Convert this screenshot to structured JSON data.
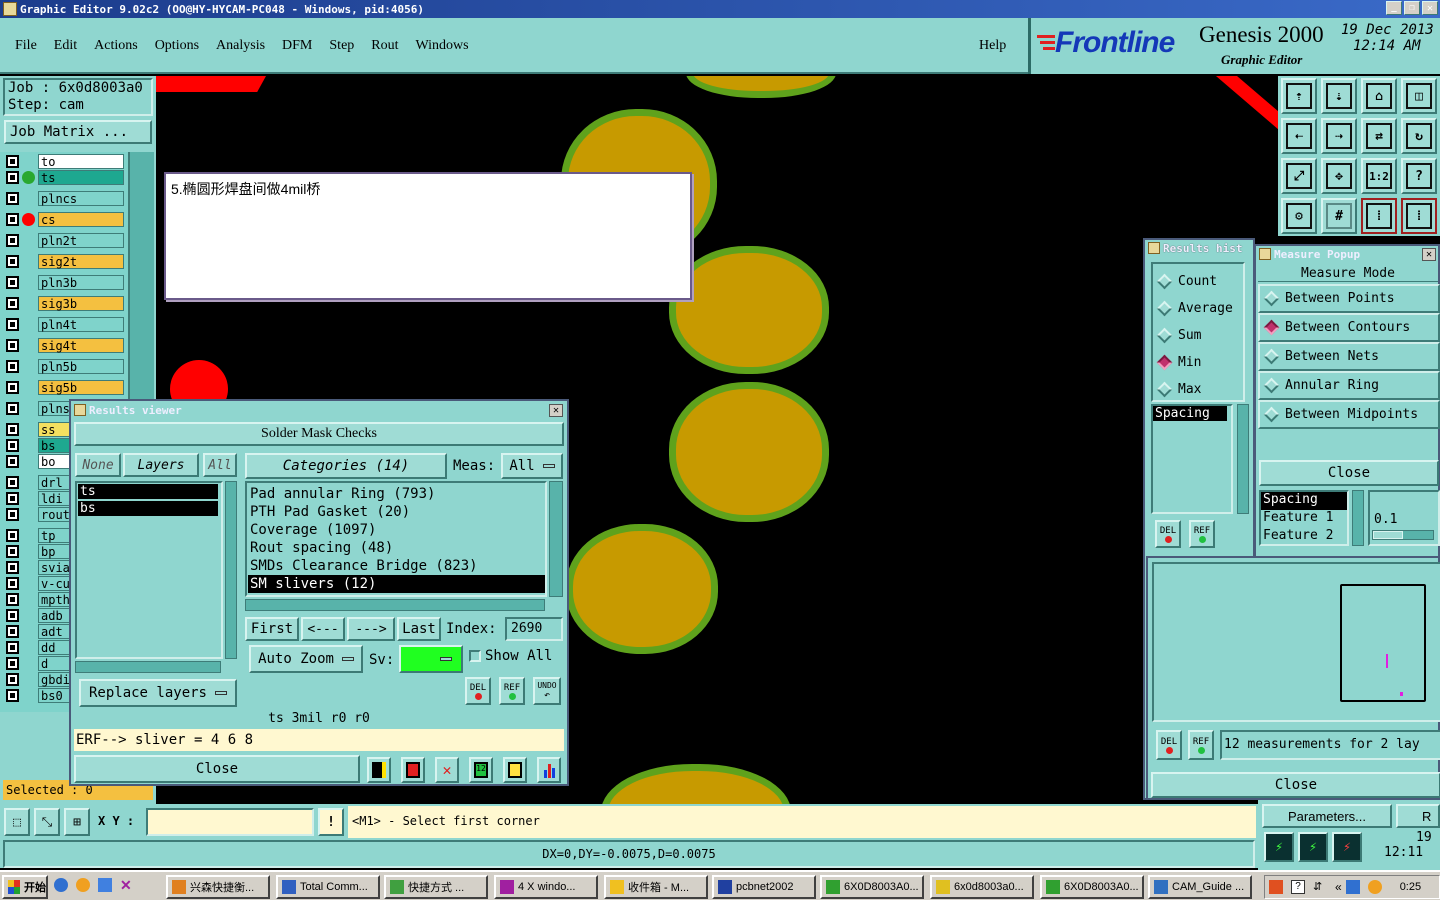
{
  "window": {
    "title": "Graphic Editor 9.02c2  (OO@HY-HYCAM-PC048 - Windows, pid:4056)"
  },
  "menu": {
    "items": [
      "File",
      "Edit",
      "Actions",
      "Options",
      "Analysis",
      "DFM",
      "Step",
      "Rout",
      "Windows"
    ],
    "help": "Help"
  },
  "brand": {
    "logo": "Frontline",
    "product": "Genesis 2000",
    "subtitle": "Graphic Editor",
    "date": "19 Dec 2013",
    "time": "12:14 AM"
  },
  "job": {
    "job_line": "Job  :  6x0d8003a0",
    "step_line": "Step: cam",
    "matrix_button": "Job Matrix ..."
  },
  "layers": [
    {
      "name": "to",
      "color": "#ffffff",
      "dot": ""
    },
    {
      "name": "ts",
      "color": "#1ea890",
      "dot": "#2aa830"
    },
    {
      "name": "plncs",
      "color": "#7fd3cb",
      "dot": ""
    },
    {
      "name": "cs",
      "color": "#f4c040",
      "dot": "#ff0000"
    },
    {
      "name": "pln2t",
      "color": "#7fd3cb",
      "dot": ""
    },
    {
      "name": "sig2t",
      "color": "#f4c040",
      "dot": ""
    },
    {
      "name": "pln3b",
      "color": "#7fd3cb",
      "dot": ""
    },
    {
      "name": "sig3b",
      "color": "#f4c040",
      "dot": ""
    },
    {
      "name": "pln4t",
      "color": "#7fd3cb",
      "dot": ""
    },
    {
      "name": "sig4t",
      "color": "#f4c040",
      "dot": ""
    },
    {
      "name": "pln5b",
      "color": "#7fd3cb",
      "dot": ""
    },
    {
      "name": "sig5b",
      "color": "#f4c040",
      "dot": ""
    },
    {
      "name": "plns",
      "color": "#7fd3cb",
      "dot": ""
    },
    {
      "name": "ss",
      "color": "#f4e060",
      "dot": ""
    },
    {
      "name": "bs",
      "color": "#1ea890",
      "dot": ""
    },
    {
      "name": "bo",
      "color": "#ffffff",
      "dot": ""
    },
    {
      "name": "drl",
      "color": "#7fd3cb",
      "dot": ""
    },
    {
      "name": "ldi",
      "color": "#7fd3cb",
      "dot": ""
    },
    {
      "name": "rout",
      "color": "#7fd3cb",
      "dot": ""
    },
    {
      "name": "tp",
      "color": "#7fd3cb",
      "dot": ""
    },
    {
      "name": "bp",
      "color": "#7fd3cb",
      "dot": ""
    },
    {
      "name": "svia",
      "color": "#7fd3cb",
      "dot": ""
    },
    {
      "name": "v-cu",
      "color": "#7fd3cb",
      "dot": ""
    },
    {
      "name": "mpth",
      "color": "#7fd3cb",
      "dot": ""
    },
    {
      "name": "adb",
      "color": "#7fd3cb",
      "dot": ""
    },
    {
      "name": "adt",
      "color": "#7fd3cb",
      "dot": ""
    },
    {
      "name": "dd",
      "color": "#7fd3cb",
      "dot": ""
    },
    {
      "name": "d",
      "color": "#7fd3cb",
      "dot": ""
    },
    {
      "name": "gbdi",
      "color": "#7fd3cb",
      "dot": ""
    },
    {
      "name": "bs0",
      "color": "#7fd3cb",
      "dot": ""
    }
  ],
  "selected": "Selected : 0",
  "note": {
    "text": "5.椭圆形焊盘间做4mil桥"
  },
  "results_viewer": {
    "title": "Results viewer",
    "header": "Solder Mask Checks",
    "tabs": {
      "none": "None",
      "layers": "Layers",
      "all": "All"
    },
    "layer_list": [
      "ts",
      "bs"
    ],
    "categories_label": "Categories (14)",
    "meas_label": "Meas:",
    "meas_value": "All",
    "categories": [
      "Pad annular Ring (793)",
      "PTH Pad Gasket (20)",
      "Coverage (1097)",
      "Rout spacing (48)",
      "SMDs Clearance Bridge (823)",
      "SM slivers (12)"
    ],
    "nav": {
      "first": "First",
      "prev": "<---",
      "next": "--->",
      "last": "Last",
      "index_label": "Index:",
      "index_value": "2690"
    },
    "auto_zoom": "Auto Zoom",
    "sv_label": "Sv:",
    "show_all": "Show All",
    "replace_layers": "Replace layers",
    "btn_del": "DEL",
    "btn_ref": "REF",
    "btn_undo": "UNDO",
    "info": "ts 3mil  r0  r0",
    "erf": "ERF--> sliver = 4 6 8",
    "close": "Close"
  },
  "results_history": {
    "title": "Results hist",
    "options": [
      "Count",
      "Average",
      "Sum",
      "Min",
      "Max"
    ],
    "selected": "Min",
    "list_item": "Spacing",
    "btn_del": "DEL",
    "btn_ref": "REF"
  },
  "measure_popup": {
    "title": "Measure Popup",
    "mode_label": "Measure Mode",
    "modes": [
      "Between Points",
      "Between Contours",
      "Between Nets",
      "Annular Ring",
      "Between Midpoints"
    ],
    "selected": "Between Contours",
    "close": "Close",
    "spacing_items": [
      "Spacing",
      "Feature 1",
      "Feature 2"
    ],
    "value": "0.1",
    "measurements": "12 measurements for 2 lay",
    "btn_del": "DEL",
    "btn_ref": "REF",
    "close2": "Close"
  },
  "command": {
    "xy_label": "X Y :",
    "xy_value": "",
    "prompt": "<M1> - Select first corner",
    "status": "DX=0,DY=-0.0075,D=0.0075"
  },
  "params": {
    "button": "Parameters...",
    "extra": "R",
    "date": "19",
    "time": "12:11"
  },
  "taskbar": {
    "start": "开始",
    "tasks": [
      "兴森快捷衡...",
      "Total Comm...",
      "快捷方式 ...",
      "4 X windo...",
      "收件箱 - M...",
      "pcbnet2002",
      "6X0D8003A0...",
      "6x0d8003a0...",
      "6X0D8003A0...",
      "CAM_Guide ..."
    ],
    "clock": "0:25"
  }
}
